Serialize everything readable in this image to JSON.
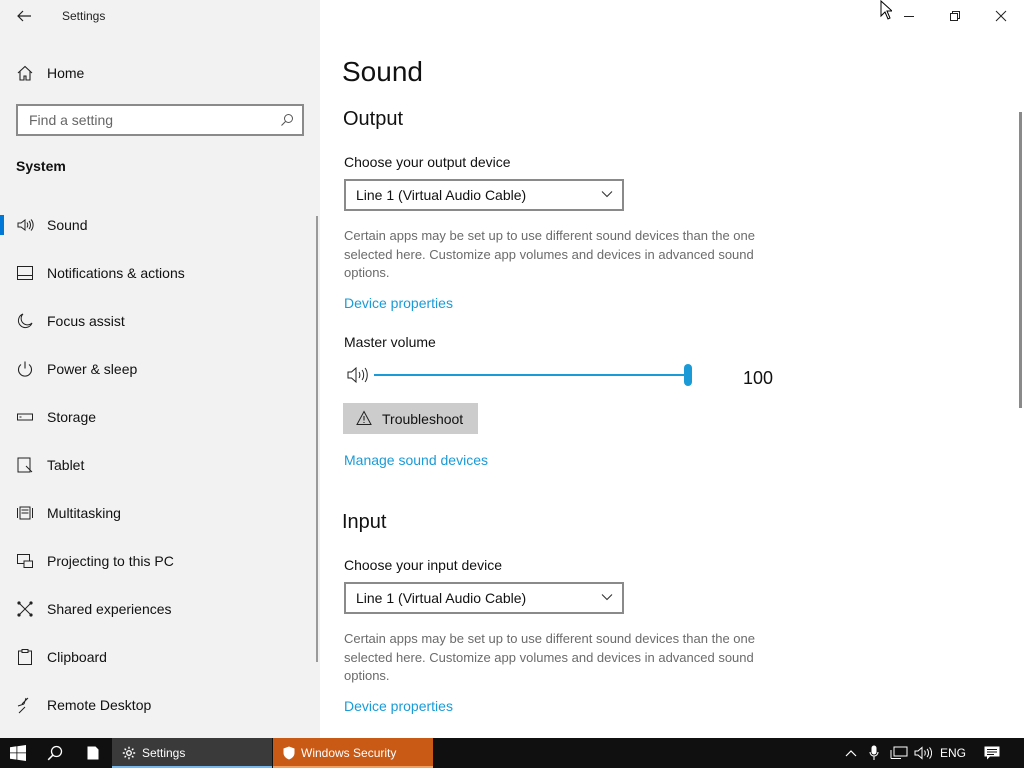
{
  "app_title": "Settings",
  "sidebar": {
    "home_label": "Home",
    "search_placeholder": "Find a setting",
    "section_title": "System",
    "items": [
      {
        "label": "Sound",
        "icon": "speaker-icon",
        "selected": true
      },
      {
        "label": "Notifications & actions",
        "icon": "notification-icon"
      },
      {
        "label": "Focus assist",
        "icon": "moon-icon"
      },
      {
        "label": "Power & sleep",
        "icon": "power-icon"
      },
      {
        "label": "Storage",
        "icon": "storage-icon"
      },
      {
        "label": "Tablet",
        "icon": "tablet-icon"
      },
      {
        "label": "Multitasking",
        "icon": "multitasking-icon"
      },
      {
        "label": "Projecting to this PC",
        "icon": "projecting-icon"
      },
      {
        "label": "Shared experiences",
        "icon": "shared-experiences-icon"
      },
      {
        "label": "Clipboard",
        "icon": "clipboard-icon"
      },
      {
        "label": "Remote Desktop",
        "icon": "remote-desktop-icon"
      }
    ]
  },
  "main": {
    "page_title": "Sound",
    "output": {
      "title": "Output",
      "device_label": "Choose your output device",
      "device_value": "Line 1 (Virtual Audio Cable)",
      "description": "Certain apps may be set up to use different sound devices than the one selected here. Customize app volumes and devices in advanced sound options.",
      "device_properties_link": "Device properties",
      "master_volume_label": "Master volume",
      "master_volume_value": "100",
      "troubleshoot_label": "Troubleshoot",
      "manage_link": "Manage sound devices"
    },
    "input": {
      "title": "Input",
      "device_label": "Choose your input device",
      "device_value": "Line 1 (Virtual Audio Cable)",
      "description": "Certain apps may be set up to use different sound devices than the one selected here. Customize app volumes and devices in advanced sound options.",
      "device_properties_link": "Device properties"
    }
  },
  "taskbar": {
    "apps": [
      {
        "label": "Settings",
        "active": true
      },
      {
        "label": "Windows Security",
        "color": "#c85a16"
      }
    ],
    "language": "ENG"
  },
  "colors": {
    "accent": "#0078d7",
    "link": "#1a9bd7",
    "sidebar_bg": "#f2f2f2",
    "taskbar_bg": "#101010"
  }
}
